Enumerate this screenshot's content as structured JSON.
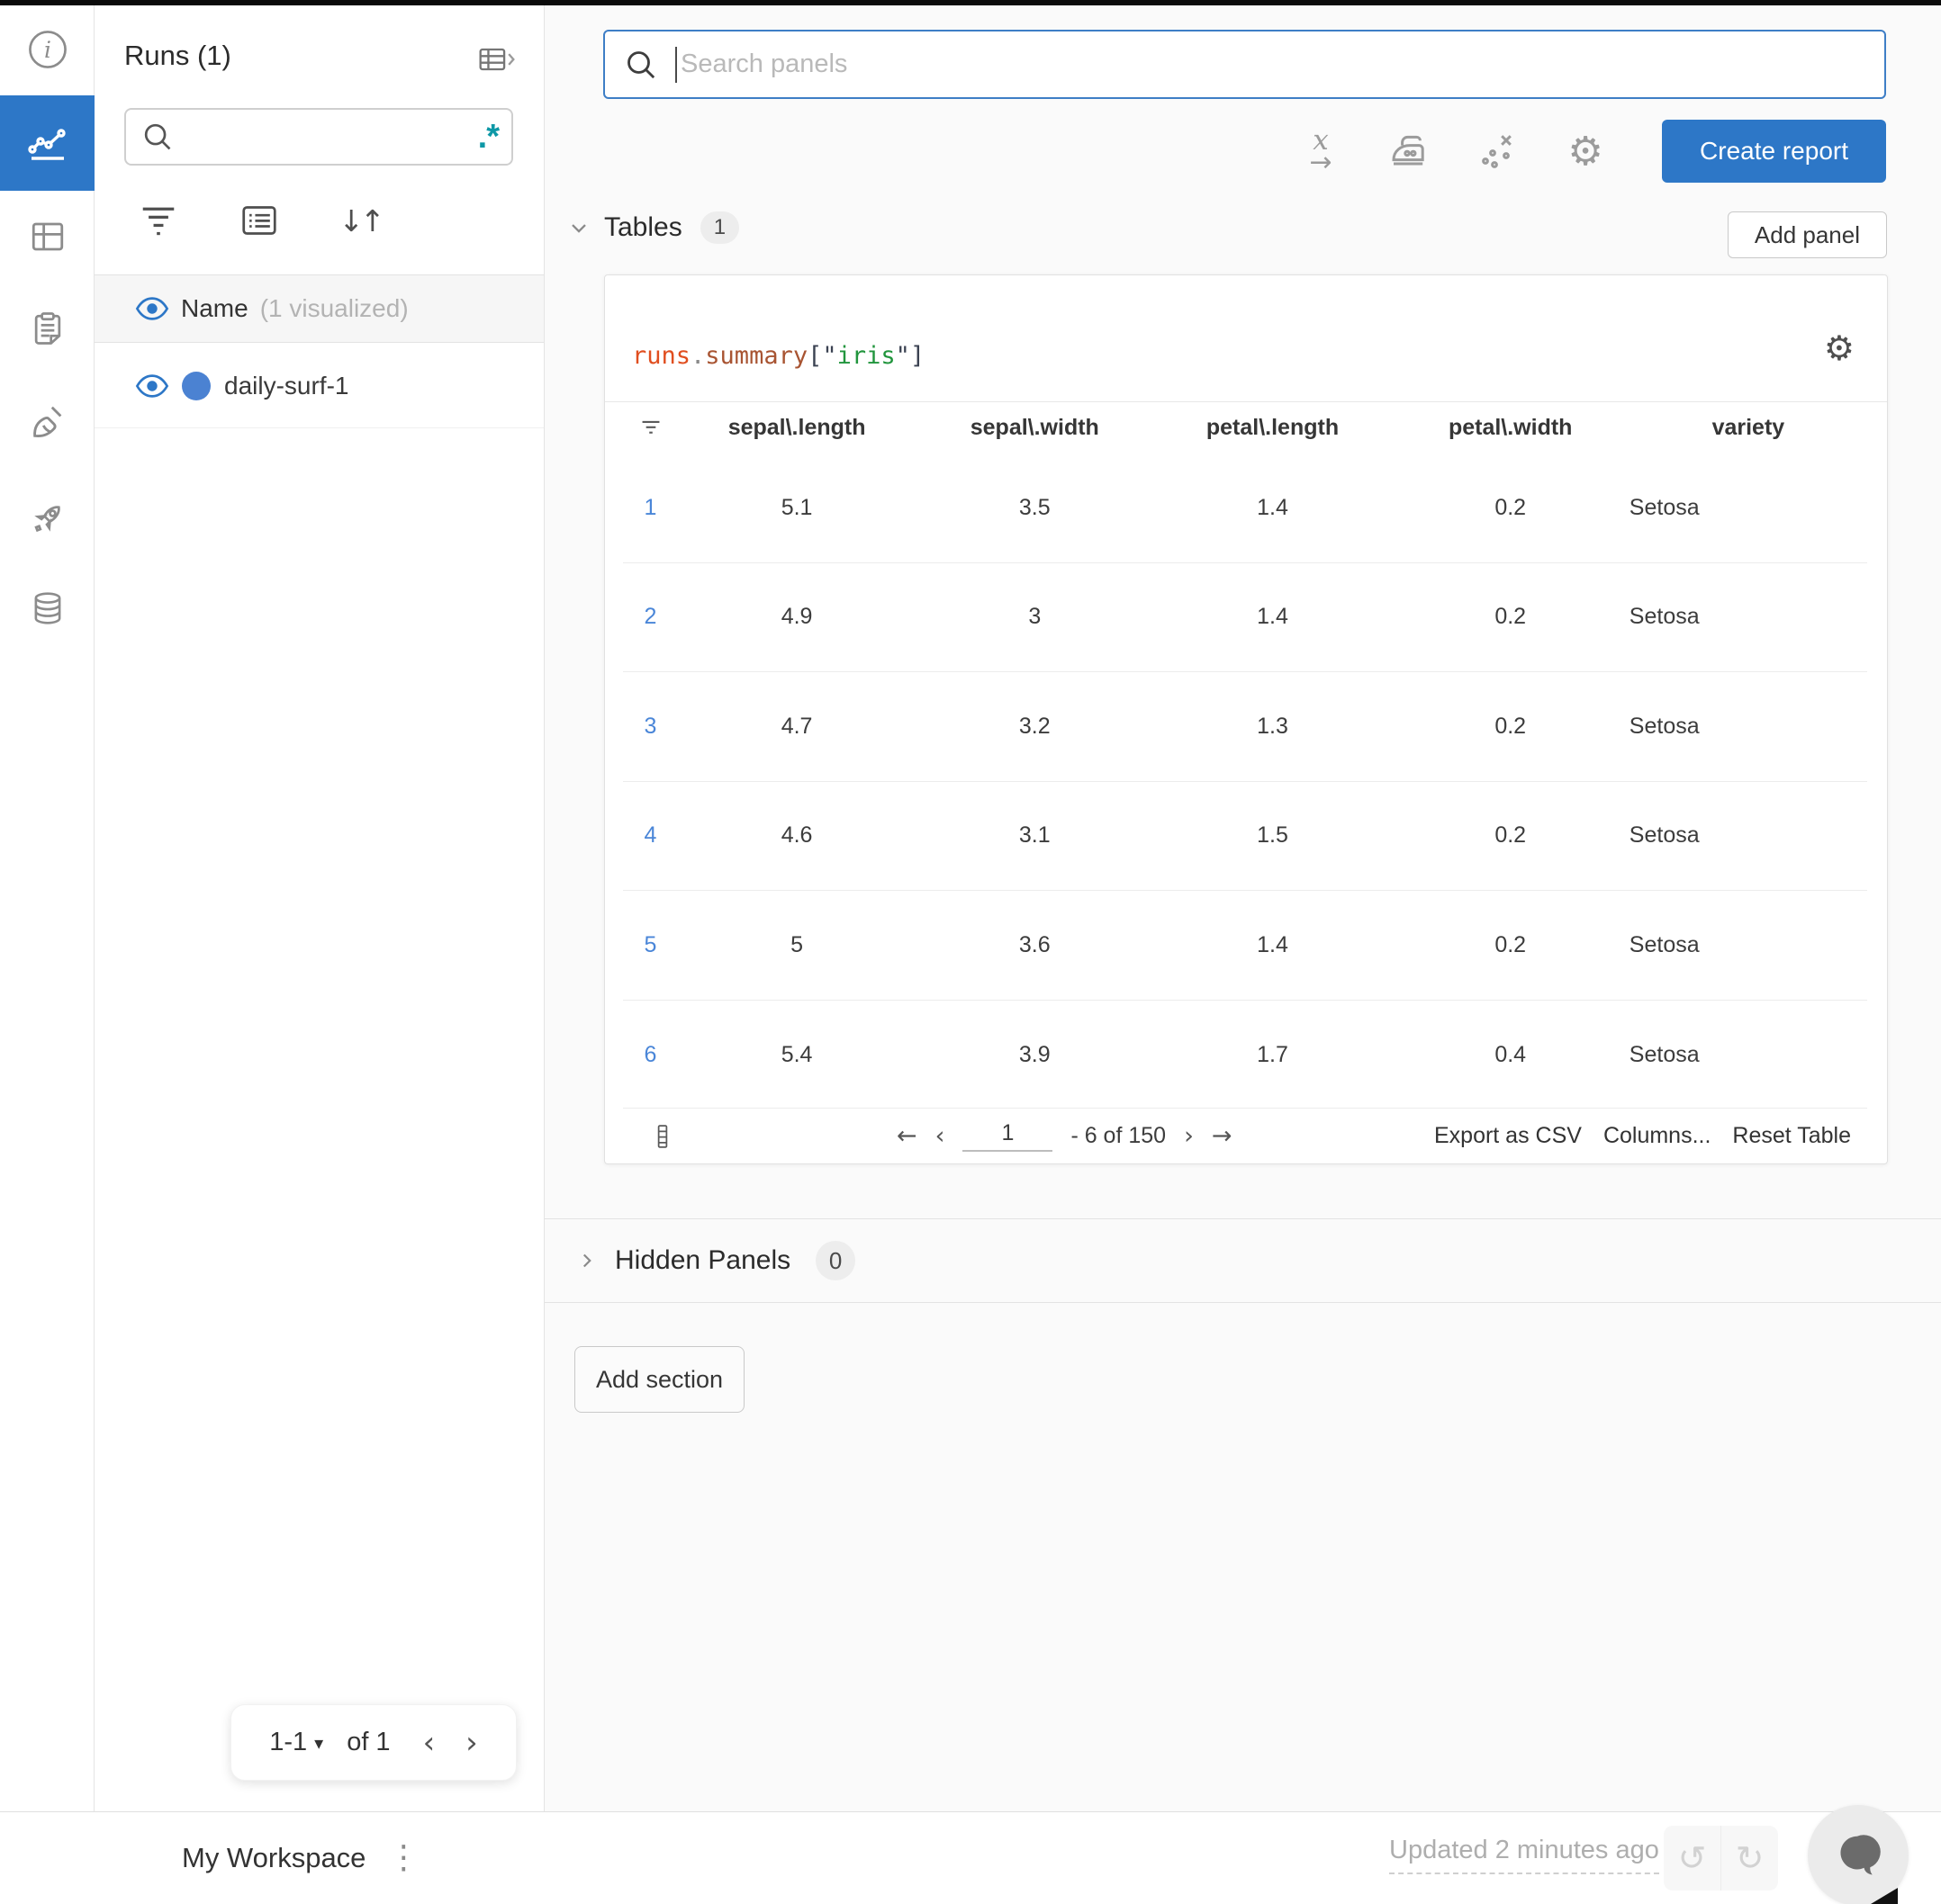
{
  "colors": {
    "accent_blue": "#2d77c7",
    "regex_teal": "#0d98a6",
    "run_dot_blue": "#4b82d2",
    "index_link_blue": "#4a86d8",
    "code_runs": "#e04e1f",
    "code_summary": "#a85432",
    "code_key_green": "#21953d"
  },
  "rail": {
    "items": [
      "info-icon",
      "workspace-chart-icon",
      "panels-icon",
      "logs-clipboard-icon",
      "sweeps-broom-icon",
      "launch-rocket-icon",
      "artifacts-database-icon"
    ],
    "active": "workspace-chart-icon"
  },
  "sidebar": {
    "title": "Runs (1)",
    "search_value": "",
    "regex_label": ".*",
    "name_header": {
      "label": "Name",
      "suffix": "(1 visualized)"
    },
    "runs": [
      {
        "name": "daily-surf-1"
      }
    ],
    "pagination": {
      "range": "1-1",
      "of": "of 1",
      "prev": "‹",
      "next": "›",
      "caret": "▾"
    }
  },
  "topbar": {
    "search_placeholder": "Search panels",
    "create_report_label": "Create report",
    "icons": [
      "x-axis-icon",
      "smoothing-iron-icon",
      "outliers-scatter-icon",
      "settings-gear-icon"
    ]
  },
  "sections": {
    "tables": {
      "label": "Tables",
      "count": "1",
      "add_panel_label": "Add panel"
    },
    "hidden": {
      "label": "Hidden Panels",
      "count": "0"
    },
    "add_section_label": "Add section"
  },
  "panel": {
    "title": {
      "runs": "runs",
      "dot": ".",
      "summary": "summary",
      "open": "[\"",
      "key": "iris",
      "close": "\"]"
    },
    "table": {
      "columns": [
        "sepal\\.length",
        "sepal\\.width",
        "petal\\.length",
        "petal\\.width",
        "variety"
      ],
      "rows": [
        {
          "index": "1",
          "values": [
            "5.1",
            "3.5",
            "1.4",
            "0.2",
            "Setosa"
          ]
        },
        {
          "index": "2",
          "values": [
            "4.9",
            "3",
            "1.4",
            "0.2",
            "Setosa"
          ]
        },
        {
          "index": "3",
          "values": [
            "4.7",
            "3.2",
            "1.3",
            "0.2",
            "Setosa"
          ]
        },
        {
          "index": "4",
          "values": [
            "4.6",
            "3.1",
            "1.5",
            "0.2",
            "Setosa"
          ]
        },
        {
          "index": "5",
          "values": [
            "5",
            "3.6",
            "1.4",
            "0.2",
            "Setosa"
          ]
        },
        {
          "index": "6",
          "values": [
            "5.4",
            "3.9",
            "1.7",
            "0.4",
            "Setosa"
          ]
        }
      ],
      "footer": {
        "page_value": "1",
        "range_suffix": "- 6 of 150",
        "prev_page": "←",
        "prev": "‹",
        "next": "›",
        "next_page": "→",
        "export_label": "Export as CSV",
        "columns_label": "Columns...",
        "reset_label": "Reset Table"
      }
    }
  },
  "bottombar": {
    "workspace_label": "My Workspace",
    "updated_label": "Updated 2 minutes ago",
    "undo": "↺",
    "redo": "↻",
    "kebab": "⋮"
  }
}
